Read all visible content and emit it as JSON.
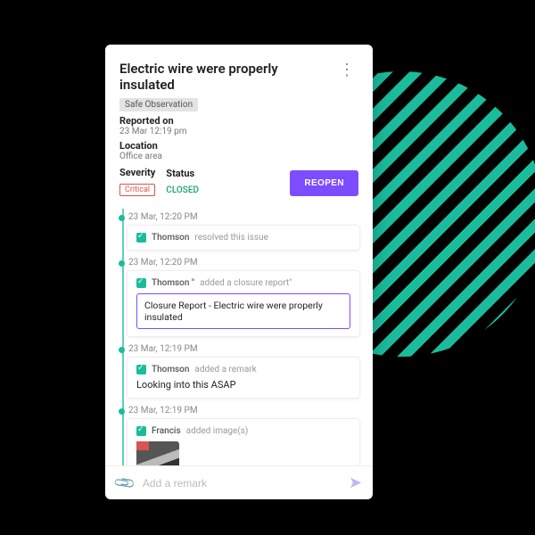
{
  "issue": {
    "title": "Electric wire were properly insulated",
    "category": "Safe Observation",
    "reported_label": "Reported on",
    "reported_value": "23 Mar 12:19 pm",
    "location_label": "Location",
    "location_value": "Office area",
    "severity_label": "Severity",
    "severity_value": "Critical",
    "status_label": "Status",
    "status_value": "CLOSED",
    "reopen_label": "REOPEN"
  },
  "events": {
    "e1": {
      "ts": "23 Mar, 12:20 PM",
      "name": "Thomson",
      "action": "resolved this issue"
    },
    "e2": {
      "ts": "23 Mar, 12:20 PM",
      "name": "Thomson \"",
      "action": "added a closure report\"",
      "attachment": "Closure Report - Electric wire were properly insulated"
    },
    "e3": {
      "ts": "23 Mar, 12:19 PM",
      "name": "Thomson",
      "action": "added a remark",
      "remark": "Looking into this ASAP"
    },
    "e4": {
      "ts": "23 Mar, 12:19 PM",
      "name": "Francis",
      "action": "added image(s)"
    }
  },
  "compose": {
    "placeholder": "Add a remark"
  }
}
